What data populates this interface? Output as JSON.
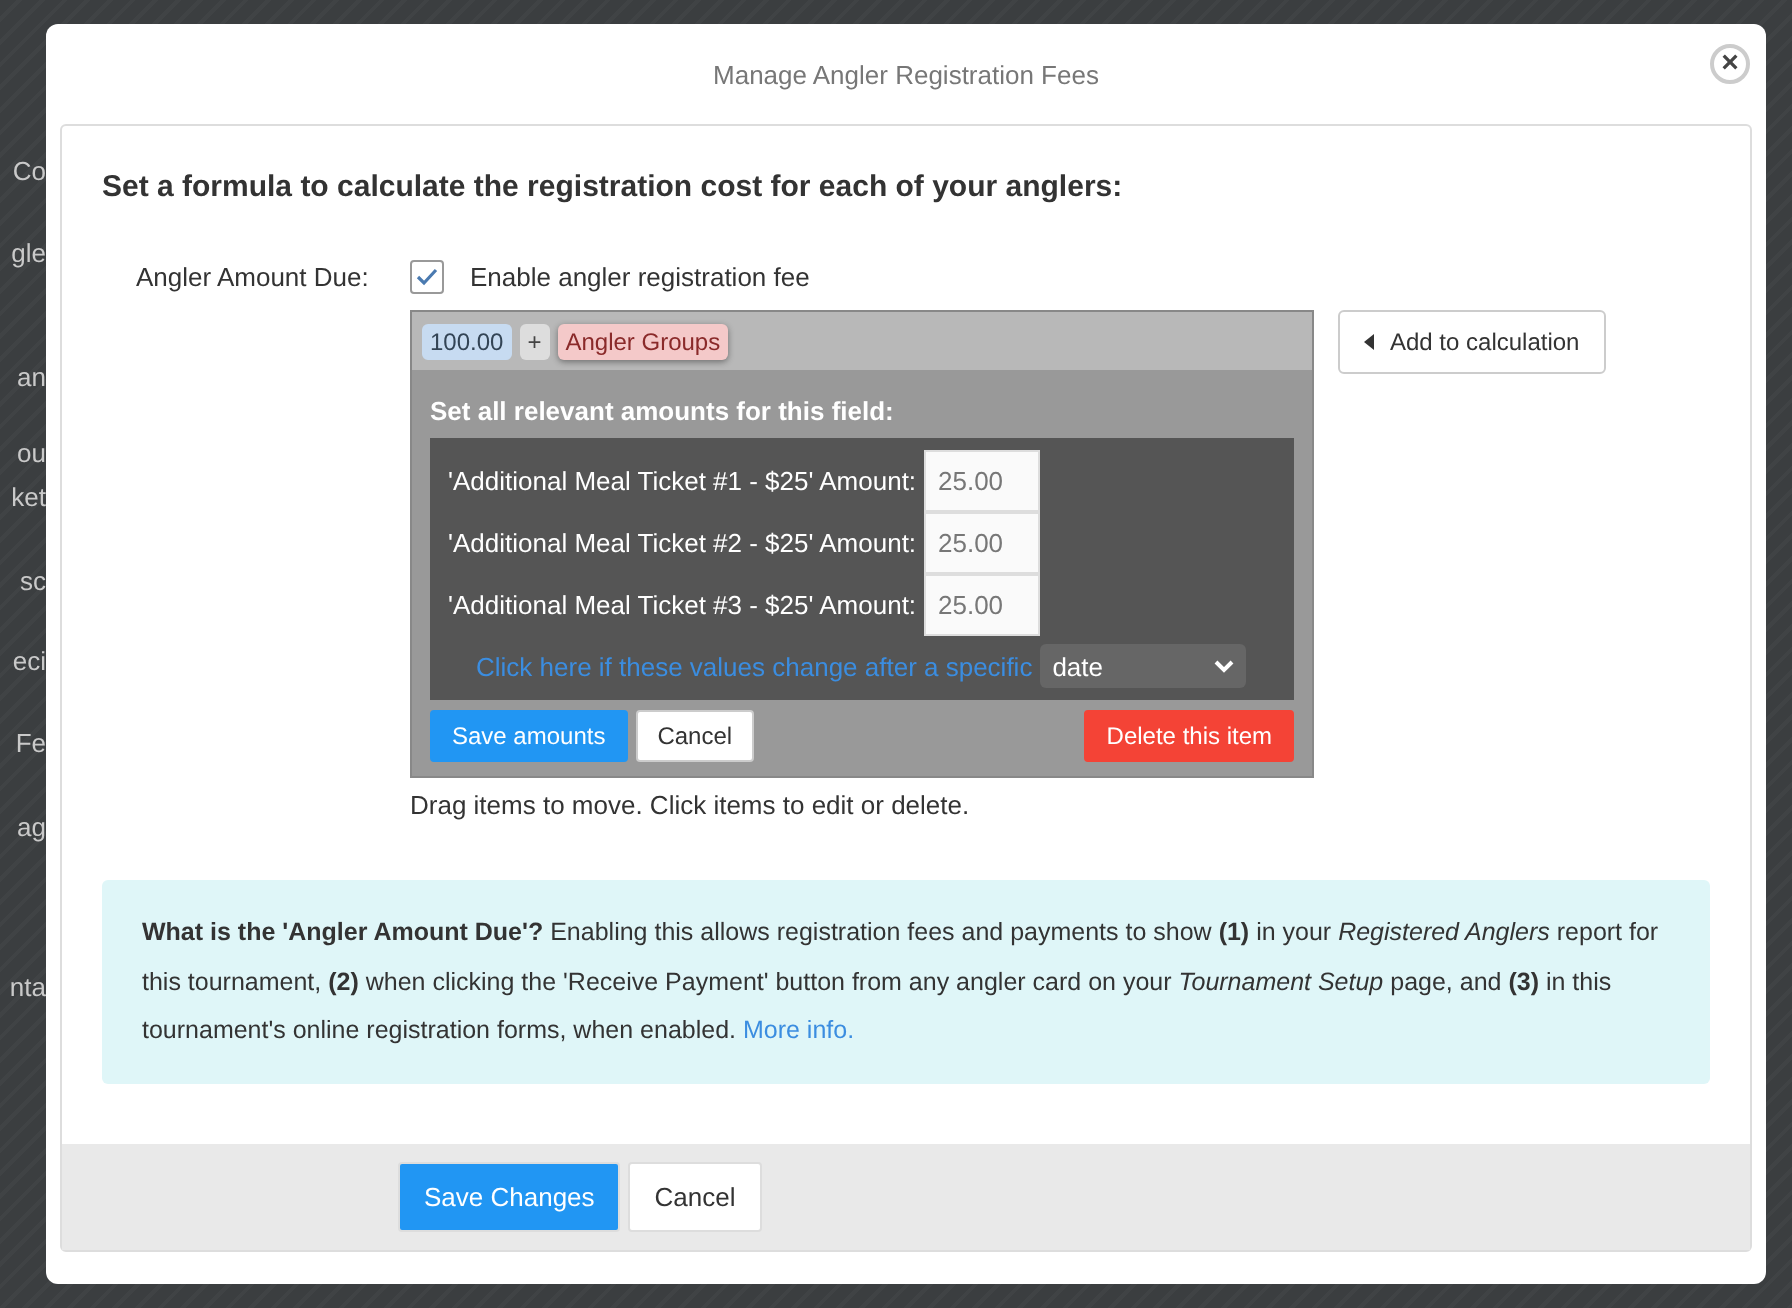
{
  "background": {
    "fragments": [
      "Co",
      "gle",
      "an",
      "ou",
      "ket",
      "sc",
      "eci",
      "Fe",
      "ag",
      "nta"
    ]
  },
  "dialog": {
    "title": "Manage Angler Registration Fees",
    "close_label": "×"
  },
  "heading": "Set a formula to calculate the registration cost for each of your anglers:",
  "amount_due": {
    "label": "Angler Amount Due:",
    "checkbox_label": "Enable angler registration fee",
    "checked": true
  },
  "formula": {
    "tokens": [
      {
        "kind": "number",
        "text": "100.00"
      },
      {
        "kind": "operator",
        "text": "+"
      },
      {
        "kind": "group",
        "text": "Angler Groups"
      }
    ],
    "editor_title": "Set all relevant amounts for this field:",
    "amounts": [
      {
        "label": "'Additional Meal Ticket #1 - $25' Amount:",
        "value": "25.00"
      },
      {
        "label": "'Additional Meal Ticket #2 - $25' Amount:",
        "value": "25.00"
      },
      {
        "label": "'Additional Meal Ticket #3 - $25' Amount:",
        "value": "25.00"
      }
    ],
    "change_link": "Click here if these values change after a specific",
    "change_select": "date",
    "save_button": "Save amounts",
    "cancel_button": "Cancel",
    "delete_button": "Delete this item",
    "hint": "Drag items to move. Click items to edit or delete."
  },
  "add_button": "Add to calculation",
  "info": {
    "text": "**What is the 'Angler Amount Due'?** Enabling this allows registration fees and payments to show **(1)** in your *Registered Anglers* report for this tournament, **(2)** when clicking the 'Receive Payment' button from any angler card on your *Tournament Setup* page, and **(3)** in this tournament's online registration forms, when enabled.",
    "link": "More info."
  },
  "footer": {
    "save_button": "Save Changes",
    "cancel_button": "Cancel"
  }
}
